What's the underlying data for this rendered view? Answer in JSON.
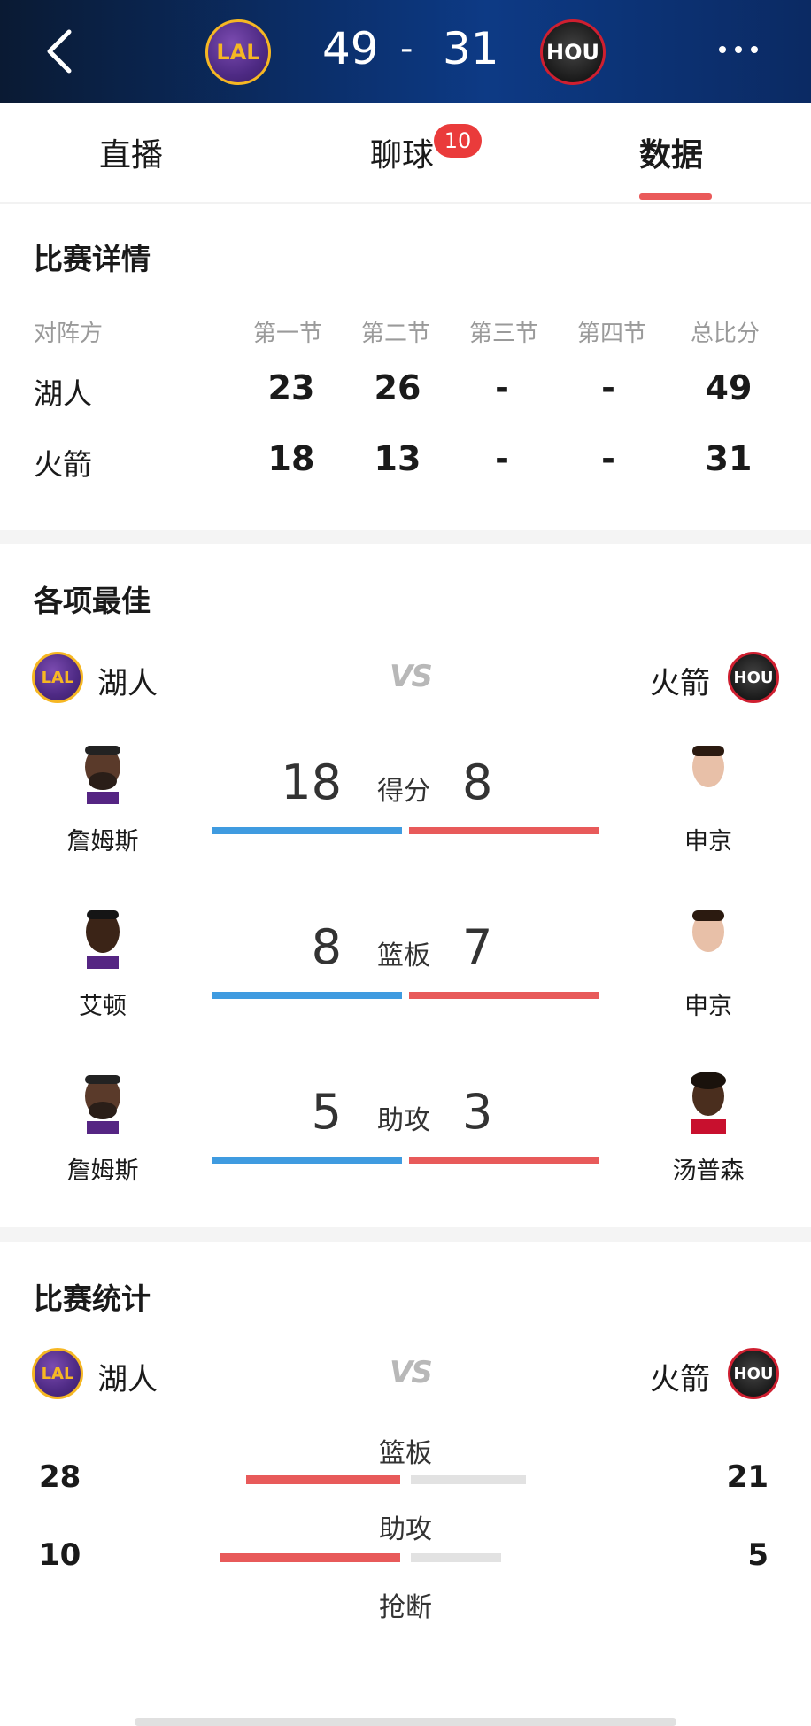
{
  "header": {
    "home_abbr": "LAL",
    "away_abbr": "HOU",
    "home_score": "49",
    "dash": "-",
    "away_score": "31",
    "back_icon": "chevron-left",
    "more_icon": "ellipsis"
  },
  "tabs": [
    {
      "label": "直播"
    },
    {
      "label": "聊球",
      "badge": "10"
    },
    {
      "label": "数据",
      "active": true
    }
  ],
  "colors": {
    "header_start": "#0a1a33",
    "header_end": "#0d3a85",
    "accent_red": "#e85a5a",
    "home_blue": "#3f9be0",
    "lakers_purple": "#4e2a84",
    "lakers_gold": "#f6b723",
    "rockets_red": "#cf1f30"
  },
  "match_details": {
    "title": "比赛详情",
    "columns": [
      "对阵方",
      "第一节",
      "第二节",
      "第三节",
      "第四节",
      "总比分"
    ],
    "rows": [
      {
        "team": "湖人",
        "q": [
          "23",
          "26",
          "-",
          "-"
        ],
        "total": "49"
      },
      {
        "team": "火箭",
        "q": [
          "18",
          "13",
          "-",
          "-"
        ],
        "total": "31"
      }
    ]
  },
  "leaders": {
    "title": "各项最佳",
    "home_team": "湖人",
    "away_team": "火箭",
    "vs": "VS",
    "items": [
      {
        "label": "得分",
        "home_player": "詹姆斯",
        "home_value": "18",
        "away_player": "申京",
        "away_value": "8"
      },
      {
        "label": "篮板",
        "home_player": "艾顿",
        "home_value": "8",
        "away_player": "申京",
        "away_value": "7"
      },
      {
        "label": "助攻",
        "home_player": "詹姆斯",
        "home_value": "5",
        "away_player": "汤普森",
        "away_value": "3"
      }
    ]
  },
  "stats": {
    "title": "比赛统计",
    "home_team": "湖人",
    "away_team": "火箭",
    "vs": "VS",
    "items": [
      {
        "label": "篮板",
        "home": "28",
        "away": "21"
      },
      {
        "label": "助攻",
        "home": "10",
        "away": "5"
      },
      {
        "label": "抢断",
        "home": "",
        "away": ""
      }
    ]
  }
}
